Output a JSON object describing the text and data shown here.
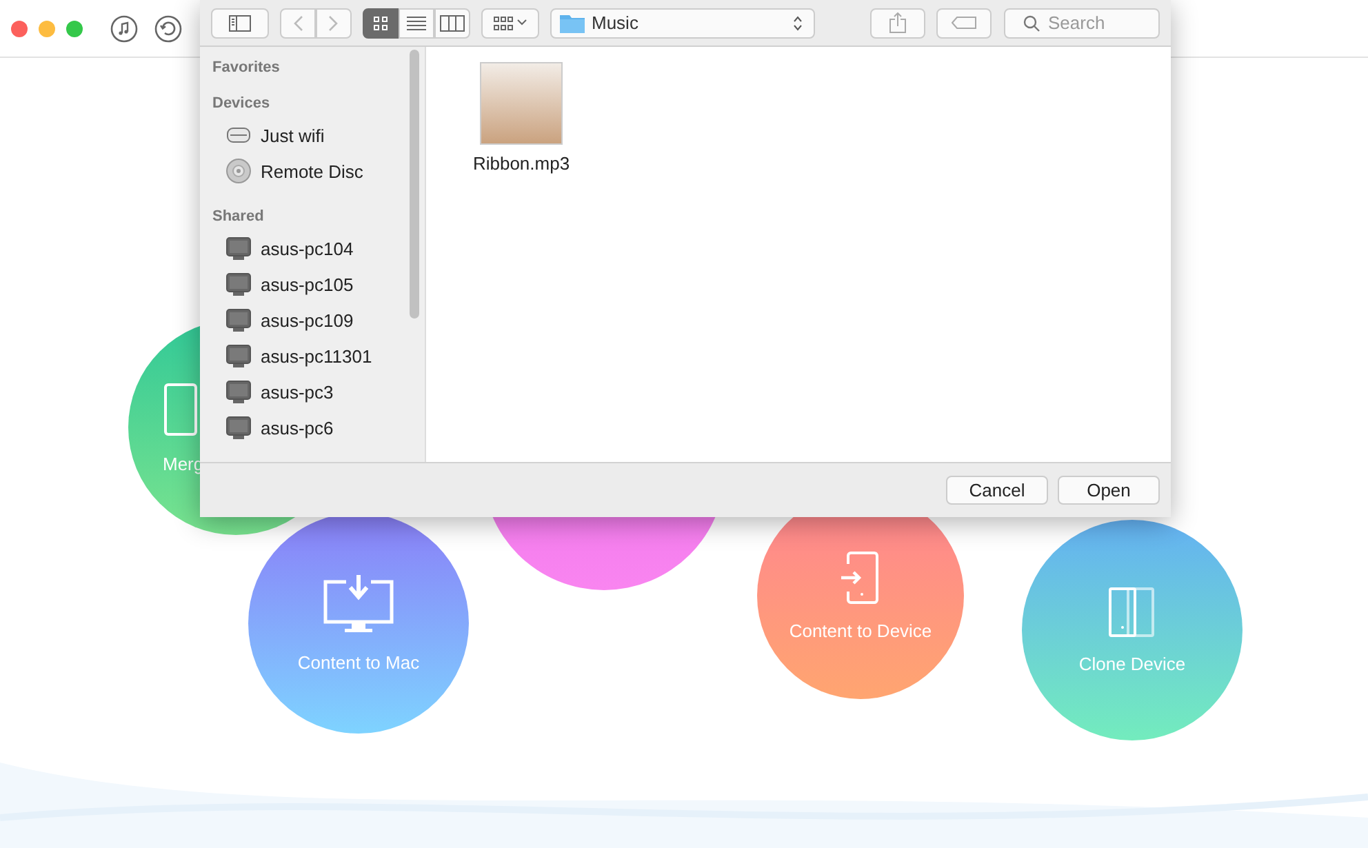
{
  "dialog": {
    "view_modes": [
      {
        "kind": "icons",
        "selected": true
      },
      {
        "kind": "list",
        "selected": false
      },
      {
        "kind": "columns",
        "selected": false
      }
    ],
    "location": "Music",
    "search": {
      "placeholder": "Search"
    },
    "sidebar": [
      {
        "title": "Favorites"
      },
      {
        "title": "Devices",
        "items": [
          {
            "label": "Just wifi",
            "kind": "drive"
          },
          {
            "label": "Remote Disc",
            "kind": "disc"
          }
        ]
      },
      {
        "title": "Shared",
        "items": [
          {
            "label": "asus-pc104",
            "kind": "computer"
          },
          {
            "label": "asus-pc105",
            "kind": "computer"
          },
          {
            "label": "asus-pc109",
            "kind": "computer"
          },
          {
            "label": "asus-pc11301",
            "kind": "computer"
          },
          {
            "label": "asus-pc3",
            "kind": "computer"
          },
          {
            "label": "asus-pc6",
            "kind": "computer"
          }
        ]
      }
    ],
    "files": [
      {
        "name": "Ribbon.mp3"
      }
    ],
    "buttons": [
      {
        "label": "Cancel"
      },
      {
        "label": "Open"
      }
    ]
  },
  "features": [
    {
      "kind": "merge",
      "label": "Merg"
    },
    {
      "kind": "itunes"
    },
    {
      "kind": "mac",
      "label": "Content to Mac"
    },
    {
      "kind": "device",
      "label": "Content to Device"
    },
    {
      "kind": "clone",
      "label": "Clone Device"
    }
  ]
}
